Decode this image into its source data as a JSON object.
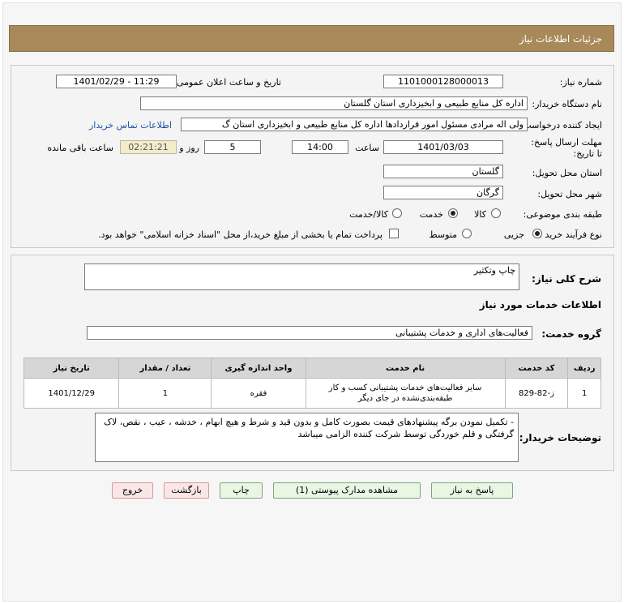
{
  "header": {
    "title": "جزئیات اطلاعات نیاز"
  },
  "form": {
    "need_number_label": "شماره نیاز:",
    "need_number": "1101000128000013",
    "announce_label": "تاریخ و ساعت اعلان عمومی:",
    "announce_value": "1401/02/29 - 11:29",
    "buyer_org_label": "نام دستگاه خریدار:",
    "buyer_org": "اداره کل منابع طبیعی و ابخیزداری استان گلستان",
    "requester_label": "ایجاد کننده درخواست:",
    "requester": "ولی اله مرادی مسئول امور قراردادها اداره کل منابع طبیعی و ابخیزداری استان گ",
    "contact_link": "اطلاعات تماس خریدار",
    "deadline_label": "مهلت ارسال پاسخ: تا تاریخ:",
    "deadline_date": "1401/03/03",
    "time_label": "ساعت",
    "deadline_time": "14:00",
    "days_value": "5",
    "days_label": "روز و",
    "remaining_time": "02:21:21",
    "remaining_label": "ساعت باقی مانده",
    "province_label": "استان محل تحویل:",
    "province": "گلستان",
    "city_label": "شهر محل تحویل:",
    "city": "گرگان",
    "category_label": "طبقه بندی موضوعی:",
    "category_options": [
      "کالا",
      "خدمت",
      "کالا/خدمت"
    ],
    "category_selected": "خدمت",
    "process_label": "نوع فرآیند خرید :",
    "process_options": [
      "جزیی",
      "متوسط"
    ],
    "process_selected": "جزیی",
    "treasury_note": "پرداخت تمام یا بخشی از مبلغ خرید،از محل \"اسناد خزانه اسلامی\" خواهد بود."
  },
  "details": {
    "summary_label": "شرح کلی نیاز:",
    "summary": "چاپ وتکثیر",
    "services_heading": "اطلاعات خدمات مورد نیاز",
    "group_label": "گروه خدمت:",
    "group": "فعالیت‌های اداری و خدمات پشتیبانی",
    "table": {
      "headers": [
        "ردیف",
        "کد خدمت",
        "نام خدمت",
        "واحد اندازه گیری",
        "تعداد / مقدار",
        "تاریخ نیاز"
      ],
      "rows": [
        [
          "1",
          "ز-82-829",
          "سایر فعالیت‌های خدمات پشتیبانی کسب و کار طبقه‌بندی‌نشده در جای دیگر",
          "فقره",
          "1",
          "1401/12/29"
        ]
      ]
    },
    "buyer_notes_label": "توضیحات خریدار:",
    "buyer_notes": "- تکمیل نمودن برگه پیشنهادهای قیمت بصورت کامل و بدون قید و شرط و هیچ ابهام ، خدشه ، عیب ، نقص، لاک گرفتگی و قلم خوردگی توسط شرکت کننده الزامی میباشد"
  },
  "buttons": {
    "reply": "پاسخ به نیاز",
    "attachments": "مشاهده مدارک پیوستی (1)",
    "print": "چاپ",
    "back": "بازگشت",
    "exit": "خروج"
  },
  "colors": {
    "title_bar": "#a8895a",
    "link": "#1a55a8",
    "button_green": "#e9f6e3",
    "button_red": "#fbe6e6"
  }
}
